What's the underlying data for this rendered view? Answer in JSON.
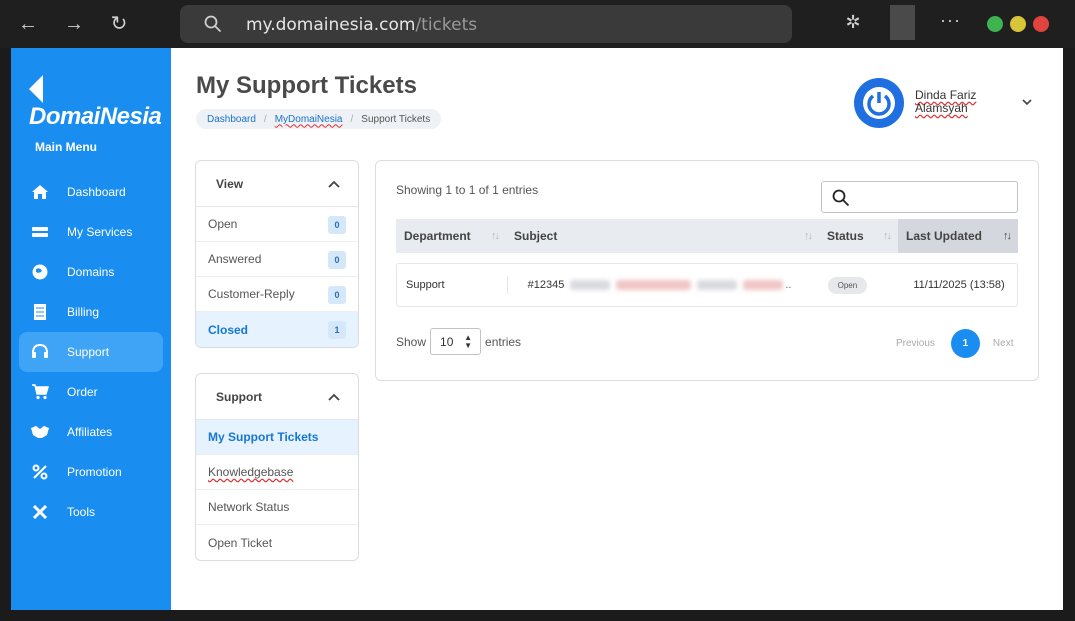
{
  "browser": {
    "url_host": "my.domainesia.com",
    "url_path": "/tickets"
  },
  "sidebar": {
    "logo": "DomaiNesia",
    "menu_title": "Main Menu",
    "items": [
      {
        "label": "Dashboard",
        "icon": "home-icon"
      },
      {
        "label": "My Services",
        "icon": "server-icon"
      },
      {
        "label": "Domains",
        "icon": "globe-icon"
      },
      {
        "label": "Billing",
        "icon": "receipt-icon"
      },
      {
        "label": "Support",
        "icon": "headset-icon",
        "active": true
      },
      {
        "label": "Order",
        "icon": "cart-icon"
      },
      {
        "label": "Affiliates",
        "icon": "handshake-icon"
      },
      {
        "label": "Promotion",
        "icon": "percent-icon"
      },
      {
        "label": "Tools",
        "icon": "tools-icon"
      }
    ]
  },
  "header": {
    "title": "My Support Tickets",
    "breadcrumb": [
      "Dashboard",
      "MyDomaiNesia",
      "Support Tickets"
    ],
    "user_name": "Dinda Fariz Alamsyah"
  },
  "view_panel": {
    "title": "View",
    "items": [
      {
        "label": "Open",
        "count": "0"
      },
      {
        "label": "Answered",
        "count": "0"
      },
      {
        "label": "Customer-Reply",
        "count": "0"
      },
      {
        "label": "Closed",
        "count": "1",
        "active": true
      }
    ]
  },
  "support_panel": {
    "title": "Support",
    "items": [
      {
        "label": "My Support Tickets",
        "active": true
      },
      {
        "label": "Knowledgebase"
      },
      {
        "label": "Network Status"
      },
      {
        "label": "Open Ticket"
      }
    ]
  },
  "table": {
    "info": "Showing 1 to 1 of 1 entries",
    "columns": [
      "Department",
      "Subject",
      "Status",
      "Last Updated"
    ],
    "rows": [
      {
        "department": "Support",
        "subject": "#12345",
        "status": "Open",
        "updated": "11/11/2025 (13:58)"
      }
    ],
    "show_label": "Show",
    "page_size": "10",
    "entries_label": "entries",
    "prev": "Previous",
    "page": "1",
    "next": "Next"
  },
  "colors": {
    "brand": "#1a8ef0",
    "active_item": "#3fa3f6"
  }
}
